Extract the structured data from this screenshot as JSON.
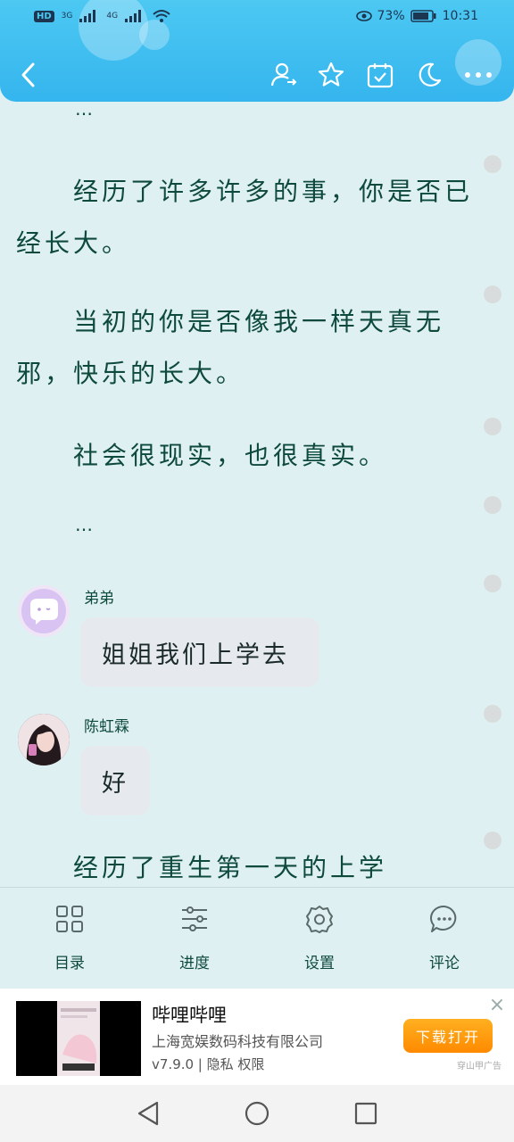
{
  "status_bar": {
    "network_hd": "HD",
    "network_3g": "3G",
    "network_4g": "4G",
    "battery_percent": "73%",
    "time": "10:31"
  },
  "toolbar": {
    "back_icon": "chevron-left-icon",
    "icons": [
      "user-switch-icon",
      "star-icon",
      "calendar-check-icon",
      "moon-icon",
      "more-icon"
    ]
  },
  "content": {
    "ellipsis_top": "…",
    "paragraph_1": "经历了许多许多的事，你是否已经长大。",
    "paragraph_2": "当初的你是否像我一样天真无邪，快乐的长大。",
    "paragraph_3": "社会很现实，也很真实。",
    "ellipsis_mid": "…",
    "chat": [
      {
        "name": "弟弟",
        "message": "姐姐我们上学去"
      },
      {
        "name": "陈虹霖",
        "message": "好"
      }
    ],
    "paragraph_4": "经历了重生第一天的上学"
  },
  "bottom_nav": {
    "items": [
      {
        "label": "目录",
        "icon": "grid-icon"
      },
      {
        "label": "进度",
        "icon": "sliders-icon"
      },
      {
        "label": "设置",
        "icon": "gear-icon"
      },
      {
        "label": "评论",
        "icon": "comment-icon"
      }
    ]
  },
  "ad": {
    "title": "哔哩哔哩",
    "company": "上海宽娱数码科技有限公司",
    "meta": "v7.9.0 | 隐私 权限",
    "button": "下载打开",
    "source": "穿山甲广告"
  },
  "colors": {
    "header": "#35b5ee",
    "background": "#dff0f2",
    "text": "#0e4a3c",
    "ad_button": "#ff8a00"
  }
}
